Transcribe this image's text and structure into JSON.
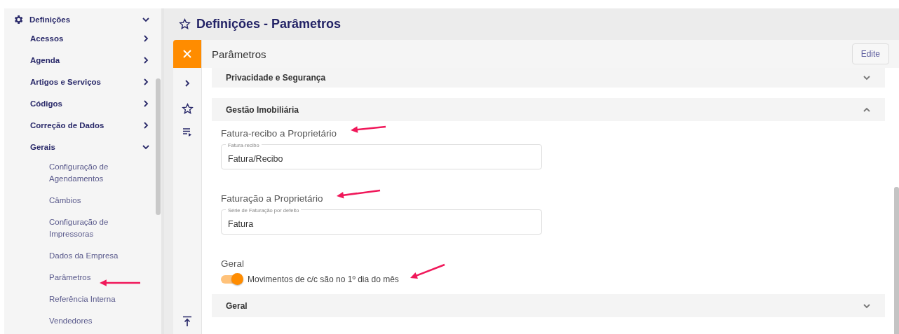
{
  "sidebar": {
    "title": "Definições",
    "expanded": true,
    "items": [
      {
        "label": "Acessos",
        "expanded": false
      },
      {
        "label": "Agenda",
        "expanded": false
      },
      {
        "label": "Artigos e Serviços",
        "expanded": false
      },
      {
        "label": "Códigos",
        "expanded": false
      },
      {
        "label": "Correção de Dados",
        "expanded": false
      },
      {
        "label": "Gerais",
        "expanded": true,
        "children": [
          {
            "label": "Configuração de Agendamentos"
          },
          {
            "label": "Câmbios"
          },
          {
            "label": "Configuração de Impressoras"
          },
          {
            "label": "Dados da Empresa"
          },
          {
            "label": "Parâmetros"
          },
          {
            "label": "Referência Interna"
          },
          {
            "label": "Vendedores"
          }
        ]
      }
    ]
  },
  "page_title": "Definições - Parâmetros",
  "panel": {
    "title": "Parâmetros",
    "edit_button": "Edite",
    "sections": [
      {
        "title": "Privacidade e Segurança",
        "expanded": false
      },
      {
        "title": "Gestão Imobiliária",
        "expanded": true,
        "groups": [
          {
            "heading": "Fatura-recibo a Proprietário",
            "kind": "field",
            "label": "Fatura-recibo",
            "value": "Fatura/Recibo"
          },
          {
            "heading": "Faturação a Proprietário",
            "kind": "field",
            "label": "Série de Faturação por defeito",
            "value": "Fatura"
          },
          {
            "heading": "Geral",
            "kind": "toggle",
            "label": "Movimentos de c/c são no 1º dia do mês",
            "on": true
          }
        ]
      },
      {
        "title": "Geral",
        "expanded": false
      }
    ]
  }
}
